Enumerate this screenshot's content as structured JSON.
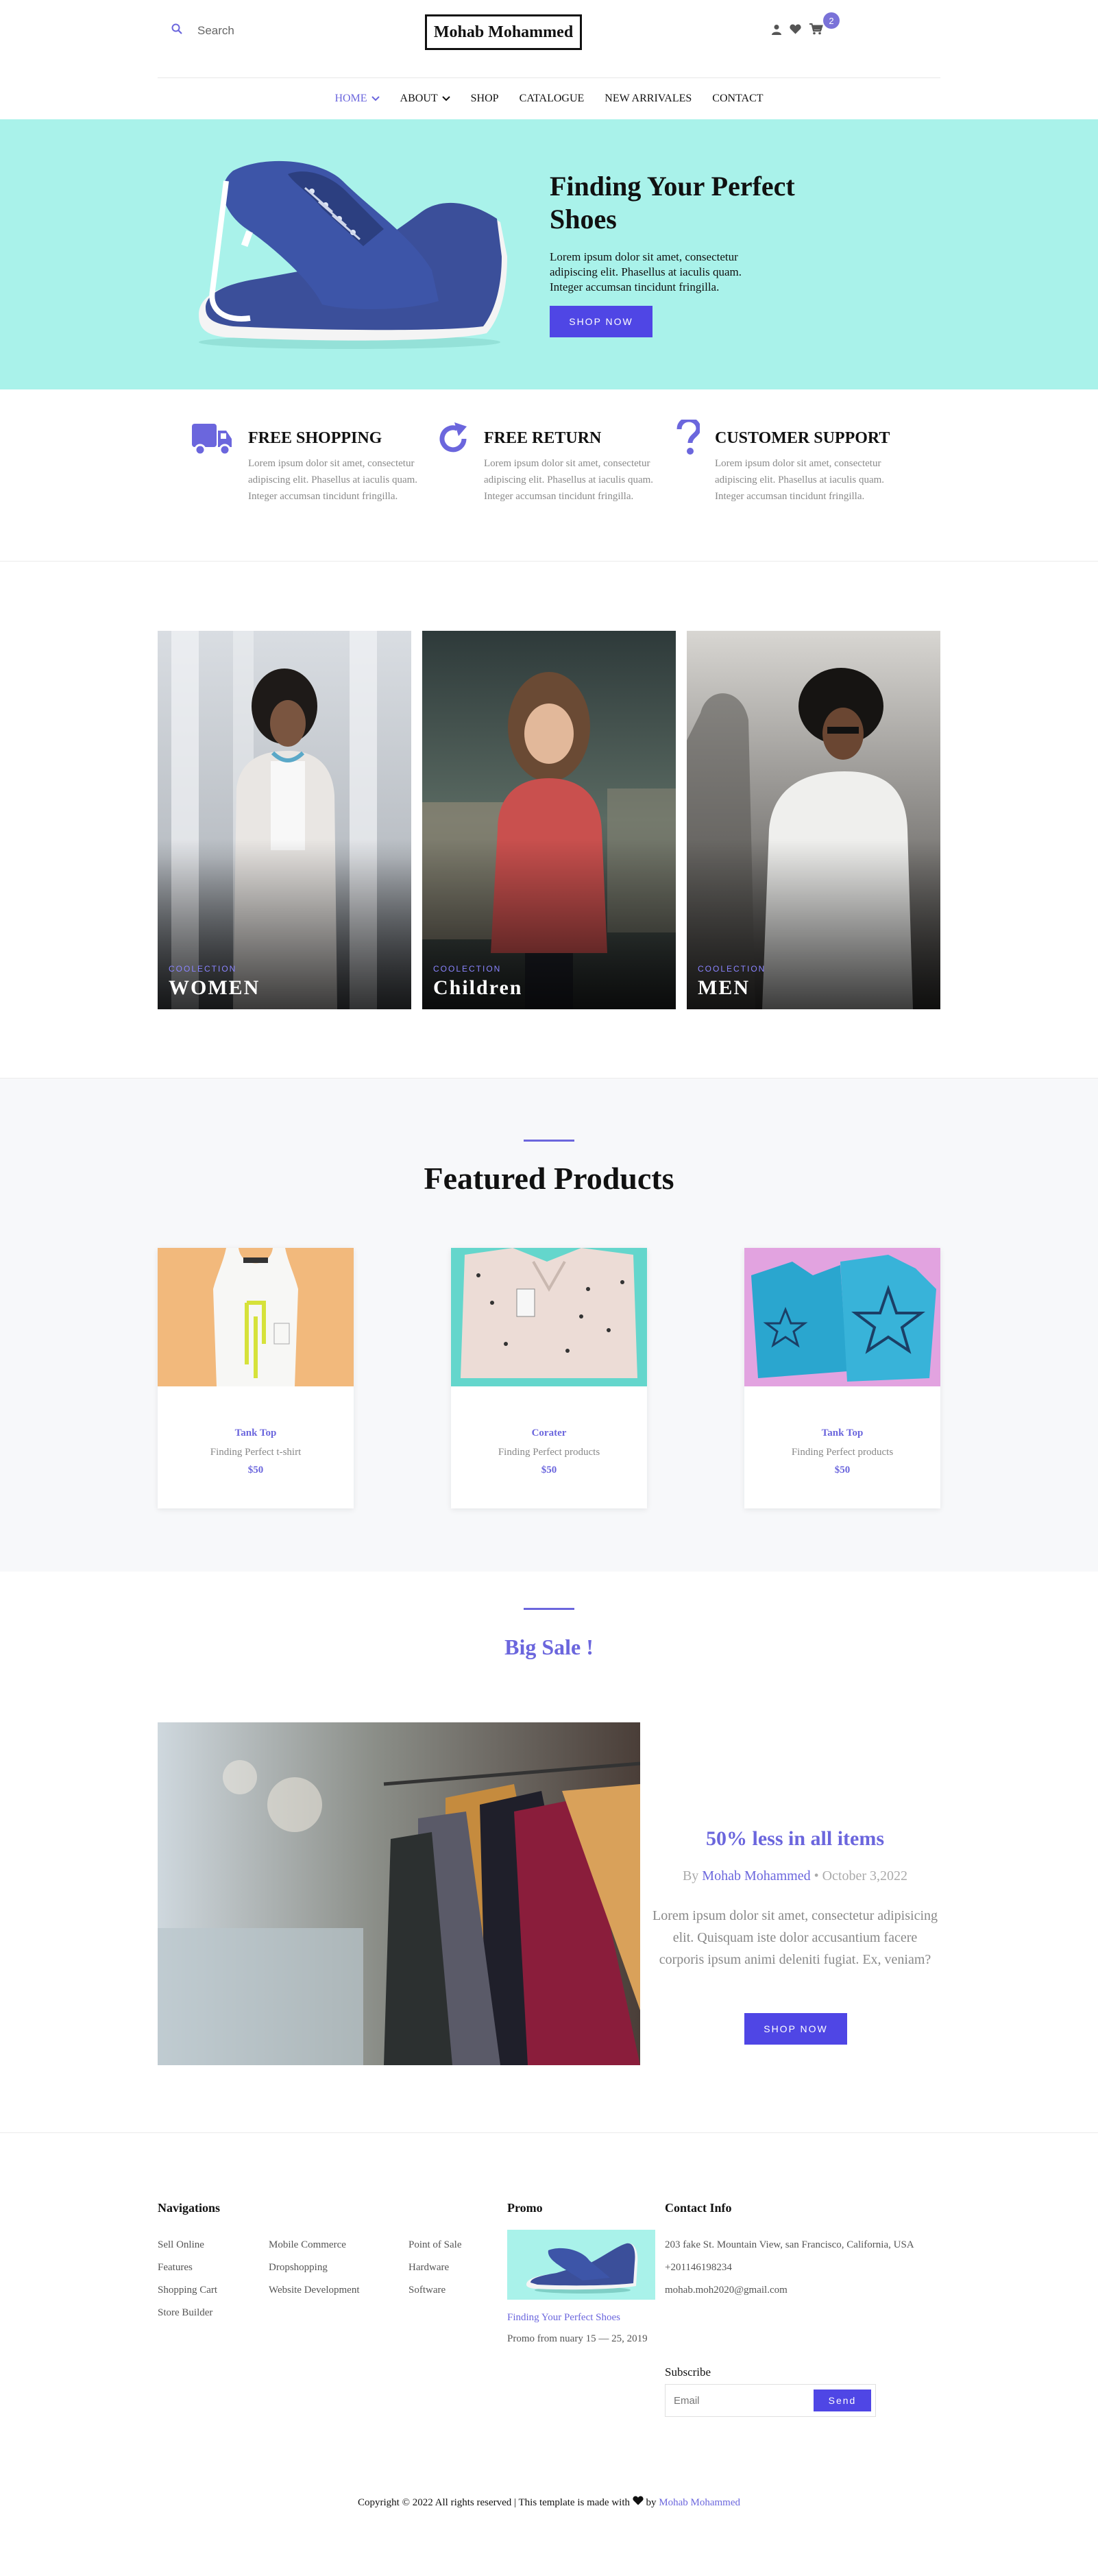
{
  "header": {
    "search_placeholder": "Search",
    "logo": "Mohab Mohammed",
    "cart_count": "2"
  },
  "nav": {
    "items": [
      {
        "label": "HOME",
        "dropdown": true,
        "active": true
      },
      {
        "label": "ABOUT",
        "dropdown": true,
        "active": false
      },
      {
        "label": "SHOP",
        "dropdown": false,
        "active": false
      },
      {
        "label": "CATALOGUE",
        "dropdown": false,
        "active": false
      },
      {
        "label": "NEW ARRIVALES",
        "dropdown": false,
        "active": false
      },
      {
        "label": "CONTACT",
        "dropdown": false,
        "active": false
      }
    ]
  },
  "hero": {
    "title": "Finding Your Perfect Shoes",
    "text": "Lorem ipsum dolor sit amet, consectetur adipiscing elit. Phasellus at iaculis quam. Integer accumsan tincidunt fringilla.",
    "button": "SHOP NOW"
  },
  "features": [
    {
      "icon": "truck-icon",
      "title": "FREE SHOPPING",
      "text": "Lorem ipsum dolor sit amet, consectetur adipiscing elit. Phasellus at iaculis quam. Integer accumsan tincidunt fringilla."
    },
    {
      "icon": "refresh-icon",
      "title": "FREE RETURN",
      "text": "Lorem ipsum dolor sit amet, consectetur adipiscing elit. Phasellus at iaculis quam. Integer accumsan tincidunt fringilla."
    },
    {
      "icon": "question-icon",
      "title": "CUSTOMER SUPPORT",
      "text": "Lorem ipsum dolor sit amet, consectetur adipiscing elit. Phasellus at iaculis quam. Integer accumsan tincidunt fringilla."
    }
  ],
  "collections": [
    {
      "label": "COOLECTION",
      "name": "WOMEN"
    },
    {
      "label": "COOLECTION",
      "name": "Children"
    },
    {
      "label": "COOLECTION",
      "name": "MEN"
    }
  ],
  "featured": {
    "title": "Featured Products",
    "products": [
      {
        "name": "Tank Top",
        "desc": "Finding Perfect t-shirt",
        "price": "$50"
      },
      {
        "name": "Corater",
        "desc": "Finding Perfect products",
        "price": "$50"
      },
      {
        "name": "Tank Top",
        "desc": "Finding Perfect products",
        "price": "$50"
      }
    ]
  },
  "sale": {
    "title": "Big Sale !",
    "headline": "50% less in all items",
    "by": "By",
    "author": "Mohab Mohammed",
    "date": "• October 3,2022",
    "text": "Lorem ipsum dolor sit amet, consectetur adipisicing elit. Quisquam iste dolor accusantium facere corporis ipsum animi deleniti fugiat. Ex, veniam?",
    "button": "SHOP NOW"
  },
  "footer": {
    "nav_title": "Navigations",
    "nav_col1": [
      "Sell Online",
      "Features",
      "Shopping Cart",
      "Store Builder"
    ],
    "nav_col2": [
      "Mobile Commerce",
      "Dropshopping",
      "Website Development"
    ],
    "nav_col3": [
      "Point of Sale",
      "Hardware",
      "Software"
    ],
    "promo_title": "Promo",
    "promo_link": "Finding Your Perfect Shoes",
    "promo_text": "Promo from nuary 15 — 25, 2019",
    "contact_title": "Contact Info",
    "address": "203 fake St. Mountain View, san Francisco, California, USA",
    "phone": "+201146198234",
    "email": "mohab.moh2020@gmail.com",
    "subscribe_title": "Subscribe",
    "subscribe_placeholder": "Email",
    "subscribe_button": "Send",
    "copyright": "Copyright © 2022 All rights reserved | This template is made with",
    "copyright_by": "by",
    "copyright_author": "Mohab Mohammed"
  },
  "colors": {
    "accent": "#6b66dd",
    "button": "#4f46e5",
    "hero_bg": "#a9f2ea"
  }
}
